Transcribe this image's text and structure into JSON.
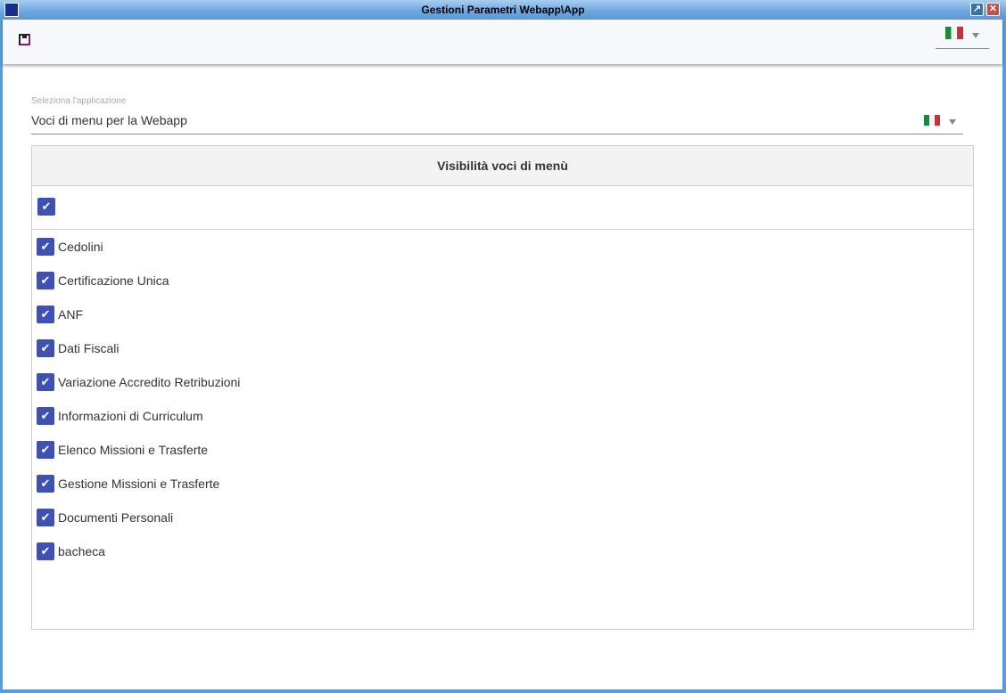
{
  "window": {
    "title": "Gestioni Parametri Webapp\\App"
  },
  "toolbar": {
    "save_icon": "floppy-disk-icon",
    "language": "it"
  },
  "selector": {
    "label": "Seleziona l'applicazione",
    "value": "Voci di menu per la Webapp"
  },
  "panel": {
    "header": "Visibilità voci di menù",
    "select_all_checked": true,
    "items": [
      {
        "label": "Cedolini",
        "checked": true
      },
      {
        "label": "Certificazione Unica",
        "checked": true
      },
      {
        "label": "ANF",
        "checked": true
      },
      {
        "label": "Dati Fiscali",
        "checked": true
      },
      {
        "label": "Variazione Accredito Retribuzioni",
        "checked": true
      },
      {
        "label": "Informazioni di Curriculum",
        "checked": true
      },
      {
        "label": "Elenco Missioni e Trasferte",
        "checked": true
      },
      {
        "label": "Gestione Missioni e Trasferte",
        "checked": true
      },
      {
        "label": "Documenti Personali",
        "checked": true
      },
      {
        "label": "bacheca",
        "checked": true
      }
    ]
  },
  "colors": {
    "accent": "#3f51b5"
  }
}
